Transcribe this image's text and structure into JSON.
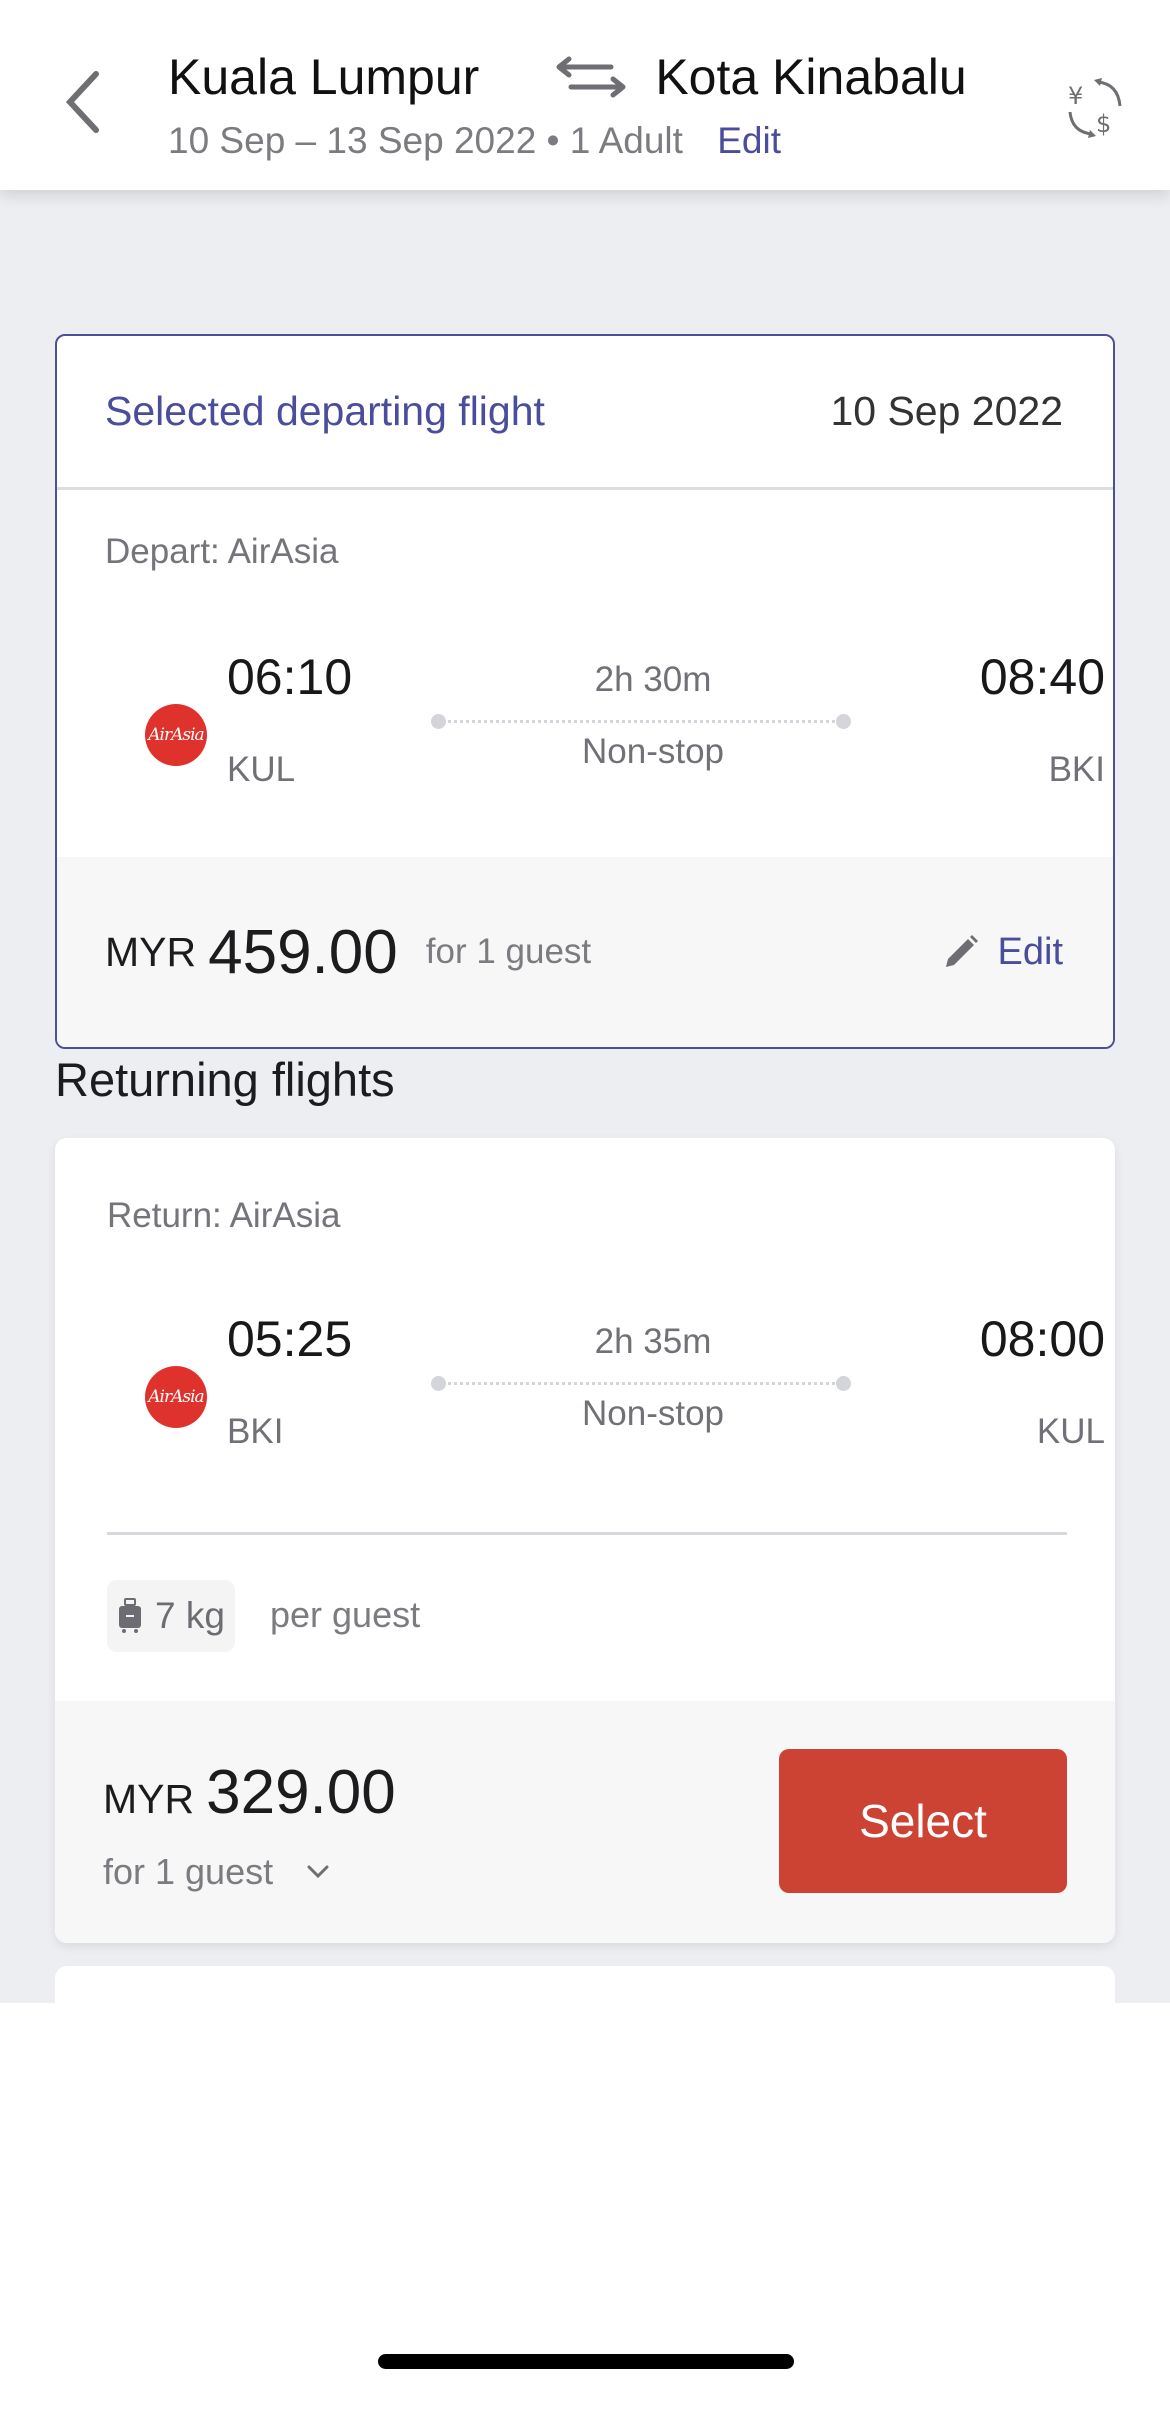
{
  "header": {
    "origin": "Kuala Lumpur",
    "destination": "Kota Kinabalu",
    "dates": "10 Sep – 13 Sep 2022",
    "passengers": "• 1 Adult",
    "edit_label": "Edit",
    "icons": {
      "back": "chevron-left-icon",
      "swap": "swap-arrows-icon",
      "currency": "currency-exchange-icon"
    }
  },
  "selected_departing": {
    "title": "Selected departing flight",
    "date": "10 Sep 2022",
    "airline_label": "Depart: AirAsia",
    "logo_text": "AirAsia",
    "depart_time": "06:10",
    "depart_code": "KUL",
    "arrive_time": "08:40",
    "arrive_code": "BKI",
    "duration": "2h 30m",
    "stops": "Non-stop",
    "currency": "MYR",
    "price": "459.00",
    "guest_label": "for 1 guest",
    "edit_label": "Edit"
  },
  "returning": {
    "section_title": "Returning flights",
    "flights": [
      {
        "airline_label": "Return: AirAsia",
        "logo_text": "AirAsia",
        "depart_time": "05:25",
        "depart_code": "BKI",
        "arrive_time": "08:00",
        "arrive_code": "KUL",
        "duration": "2h 35m",
        "stops": "Non-stop",
        "baggage": "7 kg",
        "baggage_note": "per guest",
        "currency": "MYR",
        "price": "329.00",
        "guest_label": "for 1 guest",
        "select_label": "Select"
      }
    ]
  },
  "colors": {
    "accent": "#4a4c9c",
    "select_button": "#cc4233",
    "airasia_red": "#e0322d",
    "background": "#eceef2"
  }
}
